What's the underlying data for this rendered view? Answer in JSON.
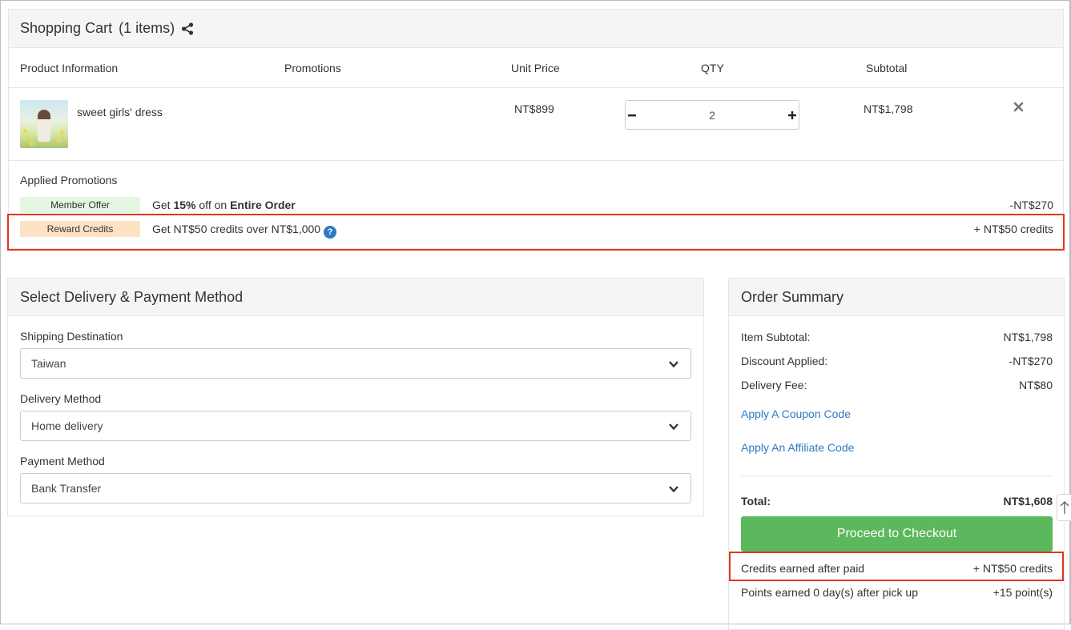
{
  "cart": {
    "title": "Shopping Cart",
    "count": "(1 items)",
    "columns": {
      "product": "Product Information",
      "promotions": "Promotions",
      "unit_price": "Unit Price",
      "qty": "QTY",
      "subtotal": "Subtotal"
    },
    "item": {
      "name": "sweet girls' dress",
      "unit_price": "NT$899",
      "qty": "2",
      "subtotal": "NT$1,798"
    },
    "applied_promotions_title": "Applied Promotions",
    "promotions": [
      {
        "tag": "Member Offer",
        "tag_color": "#e4f6e1",
        "desc_prefix": "Get ",
        "desc_bold": "15%",
        "desc_mid": " off on ",
        "desc_bold2": "Entire Order",
        "value": "-NT$270"
      },
      {
        "tag": "Reward Credits",
        "tag_color": "#fde3c3",
        "desc": "Get NT$50 credits over NT$1,000",
        "value": "+ NT$50 credits"
      }
    ]
  },
  "delivery": {
    "title": "Select Delivery & Payment Method",
    "shipping_label": "Shipping Destination",
    "shipping_value": "Taiwan",
    "method_label": "Delivery Method",
    "method_value": "Home delivery",
    "payment_label": "Payment Method",
    "payment_value": "Bank Transfer"
  },
  "summary": {
    "title": "Order Summary",
    "item_subtotal_label": "Item Subtotal:",
    "item_subtotal": "NT$1,798",
    "discount_label": "Discount Applied:",
    "discount": "-NT$270",
    "delivery_label": "Delivery Fee:",
    "delivery": "NT$80",
    "coupon_link": "Apply A Coupon Code",
    "affiliate_link": "Apply An Affiliate Code",
    "total_label": "Total:",
    "total": "NT$1,608",
    "checkout_label": "Proceed to Checkout",
    "credits_label": "Credits earned after paid",
    "credits": "+ NT$50 credits",
    "points_label": "Points earned 0 day(s) after pick up",
    "points": "+15 point(s)"
  },
  "colors": {
    "checkout": "#5cb85c",
    "link": "#2e7ac1",
    "highlight": "#e3351e"
  }
}
